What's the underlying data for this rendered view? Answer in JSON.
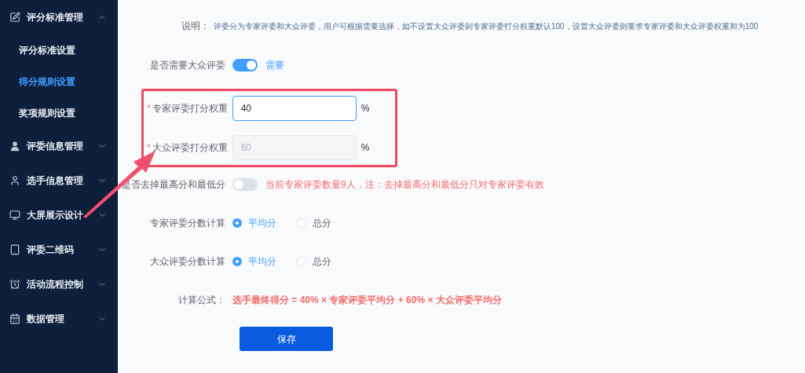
{
  "sidebar": {
    "groups": [
      {
        "label": "评分标准管理",
        "expanded": true,
        "children": [
          {
            "label": "评分标准设置",
            "selected": false
          },
          {
            "label": "得分规则设置",
            "selected": true
          },
          {
            "label": "奖项规则设置",
            "selected": false
          }
        ]
      },
      {
        "label": "评委信息管理",
        "expanded": false
      },
      {
        "label": "选手信息管理",
        "expanded": false
      },
      {
        "label": "大屏展示设计",
        "expanded": false
      },
      {
        "label": "评委二维码",
        "expanded": false
      },
      {
        "label": "活动流程控制",
        "expanded": false
      },
      {
        "label": "数据管理",
        "expanded": false
      }
    ]
  },
  "form": {
    "description": {
      "label": "说明：",
      "text": "评委分为专家评委和大众评委，用户可根据需要选择，如不设置大众评委则专家评委打分权重默认100，设置大众评委则要求专家评委和大众评委权重和为100"
    },
    "need_public": {
      "label": "是否需要大众评委",
      "on": true,
      "text": "需要"
    },
    "weights": [
      {
        "required_mark": "*",
        "label": "专家评委打分权重",
        "value": "40",
        "disabled": false,
        "unit": "%"
      },
      {
        "required_mark": "*",
        "label": "大众评委打分权重",
        "value": "60",
        "disabled": true,
        "unit": "%"
      }
    ],
    "trim": {
      "label": "是否去掉最高分和最低分",
      "on": false,
      "note": "当前专家评委数量9人，注：去掉最高分和最低分只对专家评委有效"
    },
    "radios": [
      {
        "label": "专家评委分数计算",
        "options": [
          {
            "label": "平均分",
            "selected": true
          },
          {
            "label": "总分",
            "selected": false
          }
        ]
      },
      {
        "label": "大众评委分数计算",
        "options": [
          {
            "label": "平均分",
            "selected": true
          },
          {
            "label": "总分",
            "selected": false
          }
        ]
      }
    ],
    "formula": {
      "label": "计算公式：",
      "text": "选手最终得分 = 40% × 专家评委平均分 + 60% × 大众评委平均分"
    },
    "save": "保存"
  }
}
